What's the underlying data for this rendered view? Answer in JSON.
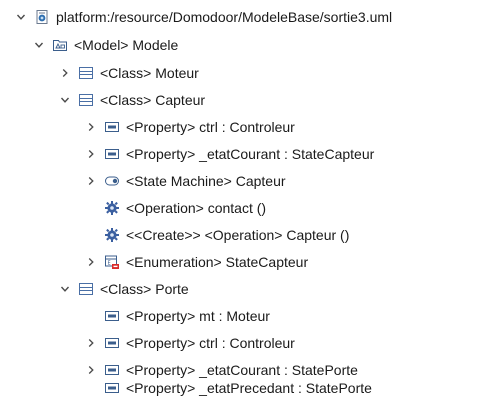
{
  "tree": {
    "root": {
      "label": "platform:/resource/Domodoor/ModeleBase/sortie3.uml",
      "expanded": true,
      "icon": "uml-resource-icon"
    },
    "model": {
      "label": "<Model> Modele",
      "expanded": true,
      "icon": "model-package-icon"
    },
    "items": [
      {
        "label": "<Class> Moteur",
        "expanded": false,
        "icon": "class-icon"
      },
      {
        "label": "<Class> Capteur",
        "expanded": true,
        "icon": "class-icon"
      },
      {
        "label": "<Property> ctrl : Controleur",
        "expanded": false,
        "icon": "property-icon"
      },
      {
        "label": "<Property> _etatCourant : StateCapteur",
        "expanded": false,
        "icon": "property-icon"
      },
      {
        "label": "<State Machine> Capteur",
        "expanded": false,
        "icon": "state-machine-icon"
      },
      {
        "label": "<Operation> contact ()",
        "icon": "operation-icon"
      },
      {
        "label": "<<Create>> <Operation> Capteur ()",
        "icon": "operation-icon"
      },
      {
        "label": "<Enumeration> StateCapteur",
        "expanded": false,
        "icon": "enumeration-icon"
      },
      {
        "label": "<Class> Porte",
        "expanded": true,
        "icon": "class-icon"
      },
      {
        "label": "<Property> mt : Moteur",
        "icon": "property-icon"
      },
      {
        "label": "<Property> ctrl : Controleur",
        "expanded": false,
        "icon": "property-icon"
      },
      {
        "label": "<Property> _etatCourant : StatePorte",
        "expanded": false,
        "icon": "property-icon"
      },
      {
        "label": "<Property> _etatPrecedant : StatePorte",
        "icon": "property-icon"
      }
    ]
  },
  "colors": {
    "arrow": "#5a5a5a",
    "class_icon": "#4a6fa5",
    "property_icon": "#3b5e8c",
    "operation_icon": "#3a5fa0",
    "enumeration_accent": "#d92b2b"
  }
}
